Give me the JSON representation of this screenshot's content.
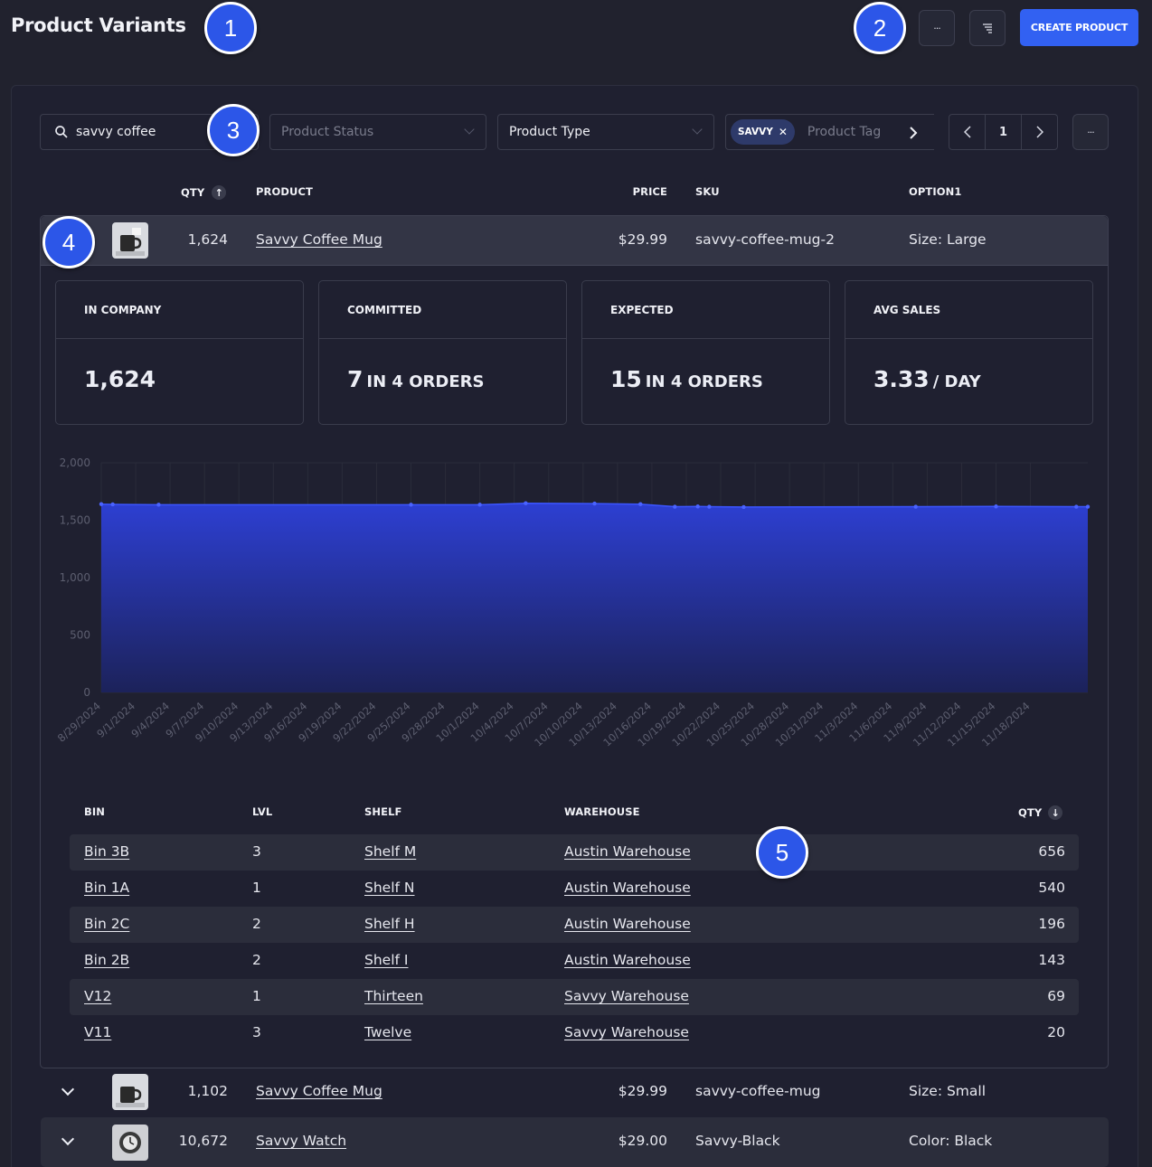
{
  "header": {
    "title": "Product Variants",
    "create_label": "CREATE PRODUCT",
    "more_label": "···"
  },
  "badges": [
    "1",
    "2",
    "3",
    "4",
    "5"
  ],
  "filters": {
    "search_value": "savvy coffee",
    "status_placeholder": "Product Status",
    "type_label": "Product Type",
    "tag_chip": "SAVVY",
    "tag_placeholder": "Product Tag",
    "page": "1"
  },
  "columns": {
    "qty": "QTY",
    "product": "PRODUCT",
    "price": "PRICE",
    "sku": "SKU",
    "option": "OPTION1"
  },
  "rows": [
    {
      "qty": "1,624",
      "product": "Savvy Coffee Mug",
      "price": "$29.99",
      "sku": "savvy-coffee-mug-2",
      "option": "Size: Large"
    },
    {
      "qty": "1,102",
      "product": "Savvy Coffee Mug",
      "price": "$29.99",
      "sku": "savvy-coffee-mug",
      "option": "Size: Small"
    },
    {
      "qty": "10,672",
      "product": "Savvy Watch",
      "price": "$29.00",
      "sku": "Savvy-Black",
      "option": "Color: Black"
    }
  ],
  "stats": [
    {
      "label": "IN COMPANY",
      "value": "1,624",
      "unit": ""
    },
    {
      "label": "COMMITTED",
      "value": "7",
      "unit": "IN 4 ORDERS"
    },
    {
      "label": "EXPECTED",
      "value": "15",
      "unit": "IN 4 ORDERS"
    },
    {
      "label": "AVG SALES",
      "value": "3.33",
      "unit": "/ DAY"
    }
  ],
  "chart_data": {
    "type": "area",
    "ylim": [
      0,
      2000
    ],
    "yticks": [
      "2,000",
      "1,500",
      "1,000",
      "500",
      "0"
    ],
    "xticks": [
      "8/29/2024",
      "9/1/2024",
      "9/4/2024",
      "9/7/2024",
      "9/10/2024",
      "9/13/2024",
      "9/16/2024",
      "9/19/2024",
      "9/22/2024",
      "9/25/2024",
      "9/28/2024",
      "10/1/2024",
      "10/4/2024",
      "10/7/2024",
      "10/10/2024",
      "10/13/2024",
      "10/16/2024",
      "10/19/2024",
      "10/22/2024",
      "10/25/2024",
      "10/28/2024",
      "10/31/2024",
      "11/3/2024",
      "11/6/2024",
      "11/9/2024",
      "11/12/2024",
      "11/15/2024",
      "11/18/2024"
    ],
    "points": [
      {
        "x": "8/29/2024",
        "y": 1640
      },
      {
        "x": "8/30/2024",
        "y": 1638
      },
      {
        "x": "9/3/2024",
        "y": 1635
      },
      {
        "x": "9/25/2024",
        "y": 1635
      },
      {
        "x": "10/1/2024",
        "y": 1635
      },
      {
        "x": "10/5/2024",
        "y": 1648
      },
      {
        "x": "10/11/2024",
        "y": 1645
      },
      {
        "x": "10/15/2024",
        "y": 1640
      },
      {
        "x": "10/18/2024",
        "y": 1618
      },
      {
        "x": "10/20/2024",
        "y": 1620
      },
      {
        "x": "10/21/2024",
        "y": 1618
      },
      {
        "x": "10/24/2024",
        "y": 1615
      },
      {
        "x": "11/8/2024",
        "y": 1618
      },
      {
        "x": "11/15/2024",
        "y": 1620
      },
      {
        "x": "11/22/2024",
        "y": 1618
      },
      {
        "x": "11/23/2024",
        "y": 1618
      }
    ],
    "grid": true,
    "color": "#2d3fd2"
  },
  "bins": {
    "columns": {
      "bin": "BIN",
      "lvl": "LVL",
      "shelf": "SHELF",
      "warehouse": "WAREHOUSE",
      "qty": "QTY"
    },
    "rows": [
      {
        "bin": "Bin 3B",
        "lvl": "3",
        "shelf": "Shelf M",
        "warehouse": "Austin Warehouse",
        "qty": "656"
      },
      {
        "bin": "Bin 1A",
        "lvl": "1",
        "shelf": "Shelf N",
        "warehouse": "Austin Warehouse",
        "qty": "540"
      },
      {
        "bin": "Bin 2C",
        "lvl": "2",
        "shelf": "Shelf H",
        "warehouse": "Austin Warehouse",
        "qty": "196"
      },
      {
        "bin": "Bin 2B",
        "lvl": "2",
        "shelf": "Shelf I",
        "warehouse": "Austin Warehouse",
        "qty": "143"
      },
      {
        "bin": "V12",
        "lvl": "1",
        "shelf": "Thirteen",
        "warehouse": "Savvy Warehouse",
        "qty": "69"
      },
      {
        "bin": "V11",
        "lvl": "3",
        "shelf": "Twelve",
        "warehouse": "Savvy Warehouse",
        "qty": "20"
      }
    ]
  }
}
